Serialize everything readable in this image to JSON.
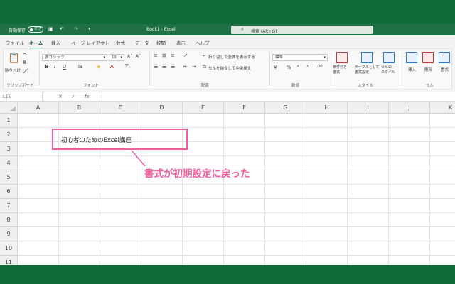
{
  "titlebar": {
    "autosave_label": "自動保存",
    "autosave_state": "オフ",
    "doc_title": "Book1  -  Excel",
    "search_placeholder": "検索 (Alt+Q)"
  },
  "tabs": [
    "ファイル",
    "ホーム",
    "挿入",
    "ページ レイアウト",
    "数式",
    "データ",
    "校閲",
    "表示",
    "ヘルプ"
  ],
  "active_tab": "ホーム",
  "ribbon": {
    "clipboard": {
      "paste_label": "貼り付け",
      "group_label": "クリップボード"
    },
    "font": {
      "font_name": "游ゴシック",
      "font_size": "11",
      "bold": "B",
      "italic": "I",
      "underline": "U",
      "group_label": "フォント"
    },
    "alignment": {
      "wrap_text": "折り返して全体を表示する",
      "merge_center": "セルを結合して中央揃え",
      "group_label": "配置"
    },
    "number": {
      "format": "標準",
      "group_label": "数値"
    },
    "styles": {
      "conditional": "条件付き\n書式",
      "table": "テーブルとして\n書式設定",
      "cell_styles": "セルの\nスタイル",
      "group_label": "スタイル"
    },
    "cells": {
      "insert": "挿入",
      "delete": "削除",
      "format": "書式",
      "group_label": "セル"
    }
  },
  "formula_bar": {
    "name_box": "L15",
    "fx": "fx"
  },
  "columns": [
    "A",
    "B",
    "C",
    "D",
    "E",
    "F",
    "G",
    "H",
    "I",
    "J",
    "K"
  ],
  "rows": [
    "1",
    "2",
    "3",
    "4",
    "5",
    "6",
    "7",
    "8",
    "9",
    "10",
    "11"
  ],
  "cells": {
    "B2": "初心者のためのExcel講座"
  },
  "annotation": {
    "text": "書式が初期設定に戻った",
    "color": "#ee5f9e"
  }
}
